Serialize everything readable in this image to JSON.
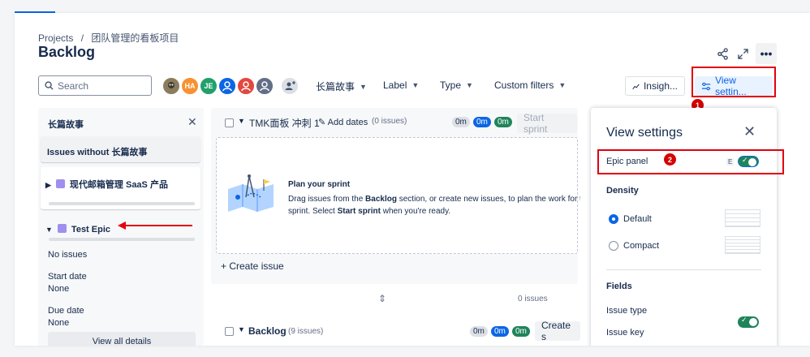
{
  "breadcrumb": {
    "projects": "Projects",
    "sep": "/",
    "project": "团队管理的看板项目"
  },
  "page_title": "Backlog",
  "search": {
    "placeholder": "Search"
  },
  "avatars": [
    {
      "initials": "",
      "color": "#8b7d5c"
    },
    {
      "initials": "HA",
      "color": "#f79232"
    },
    {
      "initials": "JE",
      "color": "#22a06b"
    },
    {
      "initials": "",
      "color": "#0c66e4"
    },
    {
      "initials": "",
      "color": "#e2483d"
    },
    {
      "initials": "",
      "color": "#626f86"
    }
  ],
  "filters": {
    "epic": "长篇故事",
    "label": "Label",
    "type": "Type",
    "custom": "Custom filters"
  },
  "toolbar": {
    "insights": "Insigh...",
    "view_settings": "View settin..."
  },
  "annotations": {
    "one": "1",
    "two": "2"
  },
  "epic_panel": {
    "heading": "长篇故事",
    "issues_without": "Issues without 长篇故事",
    "epic1": "现代邮箱管理 SaaS 产品",
    "epic2": "Test Epic",
    "no_issues": "No issues",
    "start_date_label": "Start date",
    "start_date_value": "None",
    "due_date_label": "Due date",
    "due_date_value": "None",
    "view_all": "View all details"
  },
  "sprint": {
    "name": "TMK面板 冲刺 1",
    "add_dates": "Add dates",
    "count": "(0 issues)",
    "est_grey": "0m",
    "est_blue": "0m",
    "est_green": "0m",
    "start_button": "Start sprint",
    "plan_title": "Plan your sprint",
    "plan_text_1": "Drag issues from the ",
    "plan_text_bold1": "Backlog",
    "plan_text_2": " section, or create new issues, to plan the work for th",
    "plan_text_3": "sprint. Select ",
    "plan_text_bold2": "Start sprint",
    "plan_text_4": " when you're ready.",
    "create_issue": "+ Create issue",
    "footer_count": "0 issues"
  },
  "backlog": {
    "name": "Backlog",
    "count": "(9 issues)",
    "est_grey": "0m",
    "est_blue": "0m",
    "est_green": "0m",
    "create_button": "Create s"
  },
  "view_settings": {
    "title": "View settings",
    "epic_panel": "Epic panel",
    "epic_shortcut": "E",
    "density": "Density",
    "default": "Default",
    "compact": "Compact",
    "fields": "Fields",
    "issue_type": "Issue type",
    "issue_key": "Issue key"
  }
}
